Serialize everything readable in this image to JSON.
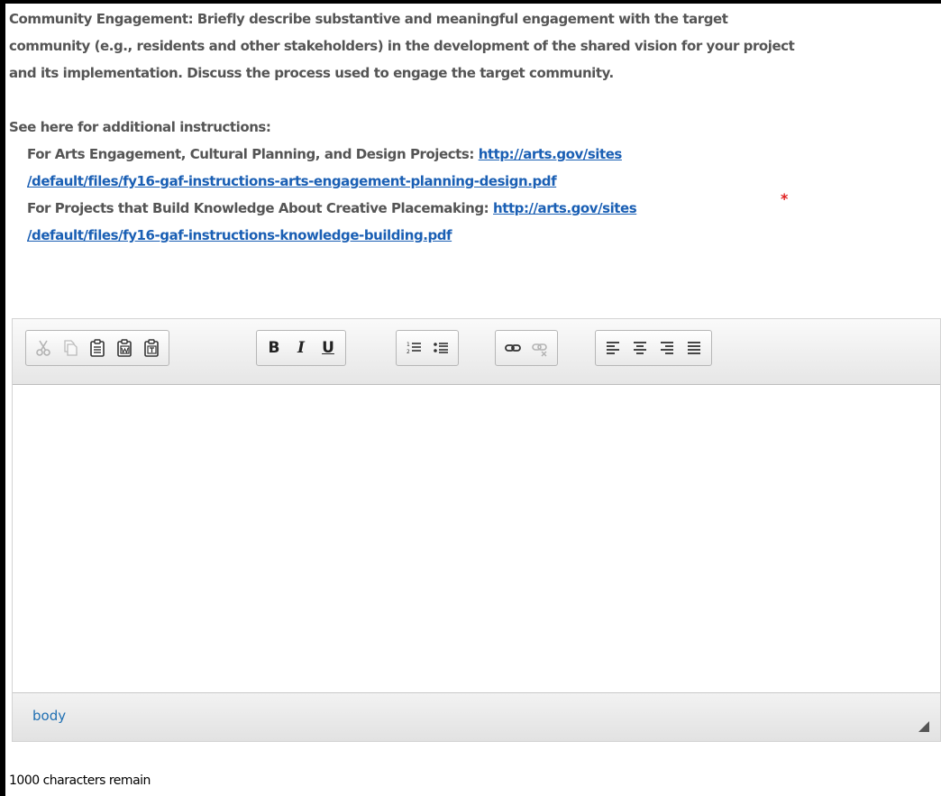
{
  "question": {
    "prompt": "Community Engagement: Briefly describe substantive and meaningful engagement with the target community (e.g., residents and other stakeholders) in the development of the shared vision for your project and its implementation. Discuss the process used to engage the target community.",
    "see_here": "See here for additional instructions:",
    "links": [
      {
        "label": "For Arts Engagement, Cultural Planning, and Design Projects: ",
        "url_line1": "http://arts.gov/sites",
        "url_line2": "/default/files/fy16-gaf-instructions-arts-engagement-planning-design.pdf"
      },
      {
        "label": "For Projects that Build Knowledge About Creative Placemaking: ",
        "url_line1": "http://arts.gov/sites",
        "url_line2": "/default/files/fy16-gaf-instructions-knowledge-building.pdf"
      }
    ],
    "required_mark": "*"
  },
  "toolbar": {
    "groups": [
      [
        "cut-icon",
        "copy-icon",
        "paste-icon",
        "paste-word-icon",
        "paste-text-icon"
      ],
      [
        "bold-icon",
        "italic-icon",
        "underline-icon"
      ],
      [
        "numbered-list-icon",
        "bulleted-list-icon"
      ],
      [
        "link-icon",
        "unlink-icon"
      ],
      [
        "align-left-icon",
        "align-center-icon",
        "align-right-icon",
        "align-justify-icon"
      ]
    ],
    "bold_label": "B",
    "italic_label": "I",
    "underline_label": "U"
  },
  "editor": {
    "content": "",
    "element_path": "body"
  },
  "counter": "1000 characters remain",
  "colors": {
    "question_text": "#555555",
    "link": "#1a5fb4",
    "required": "#e02020",
    "path": "#1f6fb2"
  }
}
